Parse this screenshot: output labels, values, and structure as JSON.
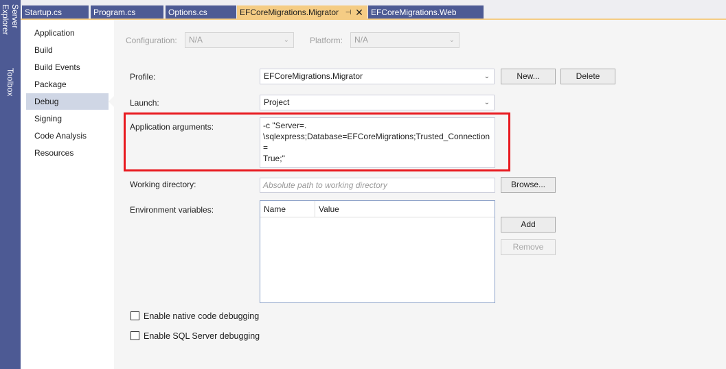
{
  "toolstrip": {
    "server_explorer": "Server Explorer",
    "toolbox": "Toolbox"
  },
  "tabs": [
    {
      "label": "Startup.cs"
    },
    {
      "label": "Program.cs"
    },
    {
      "label": "Options.cs"
    },
    {
      "label": "EFCoreMigrations.Migrator",
      "active": true
    },
    {
      "label": "EFCoreMigrations.Web"
    }
  ],
  "tab_icons": {
    "pin": "pin-icon",
    "close": "close-icon"
  },
  "nav": {
    "items": [
      {
        "label": "Application"
      },
      {
        "label": "Build"
      },
      {
        "label": "Build Events"
      },
      {
        "label": "Package"
      },
      {
        "label": "Debug",
        "selected": true
      },
      {
        "label": "Signing"
      },
      {
        "label": "Code Analysis"
      },
      {
        "label": "Resources"
      }
    ]
  },
  "config": {
    "configuration_label": "Configuration:",
    "configuration_value": "N/A",
    "platform_label": "Platform:",
    "platform_value": "N/A"
  },
  "profile": {
    "label": "Profile:",
    "value": "EFCoreMigrations.Migrator",
    "new_button": "New...",
    "delete_button": "Delete"
  },
  "launch": {
    "label": "Launch:",
    "value": "Project"
  },
  "app_args": {
    "label": "Application arguments:",
    "value": "-c \"Server=.\n\\sqlexpress;Database=EFCoreMigrations;Trusted_Connection=\nTrue;\""
  },
  "working_dir": {
    "label": "Working directory:",
    "placeholder": "Absolute path to working directory",
    "browse_button": "Browse..."
  },
  "env_vars": {
    "label": "Environment variables:",
    "columns": [
      "Name",
      "Value"
    ],
    "add_button": "Add",
    "remove_button": "Remove"
  },
  "checkboxes": {
    "native": "Enable native code debugging",
    "sql": "Enable SQL Server debugging"
  },
  "colors": {
    "highlight": "#e8191f",
    "tab_active": "#f5cc84",
    "tab_inactive": "#4d5a94",
    "nav_selected": "#cfd6e5"
  }
}
